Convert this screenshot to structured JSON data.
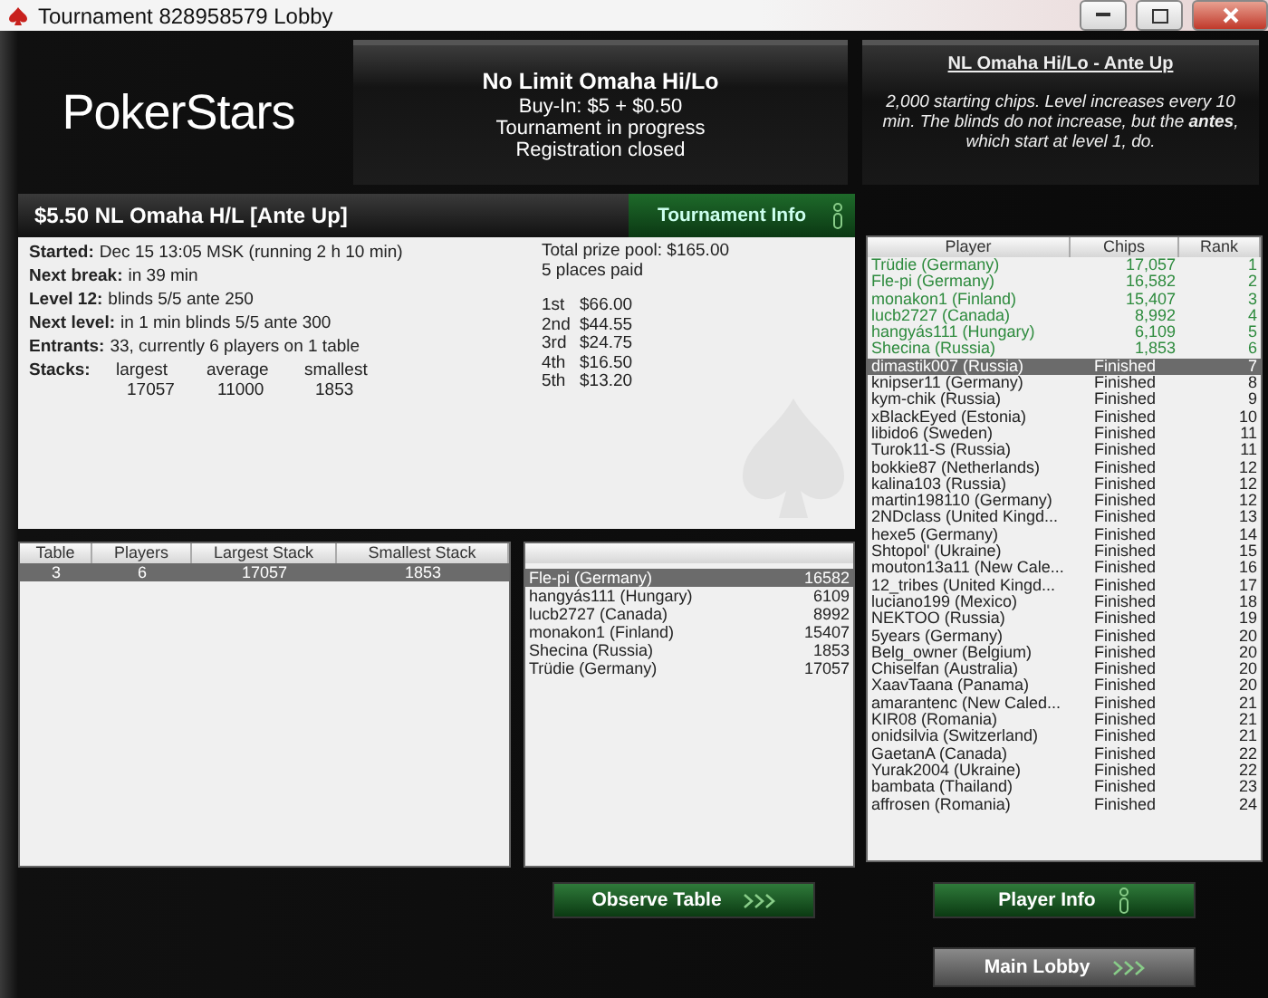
{
  "window": {
    "title": "Tournament 828958579 Lobby"
  },
  "logo": {
    "text": "PokerStars"
  },
  "summary": {
    "title": "No Limit Omaha Hi/Lo",
    "lines": [
      "Buy-In: $5 + $0.50",
      "Tournament in progress",
      "Registration closed"
    ]
  },
  "info": {
    "link": "NL Omaha Hi/Lo - Ante Up",
    "description": "2,000 starting chips. Level increases every 10 min. The blinds do not increase, but the **antes**, which start at level 1, do."
  },
  "details": {
    "title": "$5.50 NL Omaha H/L [Ante Up]",
    "tab": "Tournament Info",
    "facts": [
      {
        "label": "Started:",
        "value": "Dec 15 13:05 MSK (running 2 h 10 min)"
      },
      {
        "label": "Next break:",
        "value": "in 39 min"
      },
      {
        "label": "Level 12:",
        "value": "blinds 5/5 ante 250"
      },
      {
        "label": "Next level:",
        "value": "in 1 min blinds 5/5 ante 300"
      },
      {
        "label": "Entrants:",
        "value": "33, currently 6 players on 1 table"
      }
    ],
    "stacks": {
      "label": "Stacks:",
      "headers": [
        "largest",
        "average",
        "smallest"
      ],
      "values": [
        "17057",
        "11000",
        "1853"
      ]
    },
    "prize_pool": "Total prize pool: $165.00",
    "places_paid": "5 places paid",
    "payouts": [
      {
        "place": "1st",
        "amount": "$66.00"
      },
      {
        "place": "2nd",
        "amount": "$44.55"
      },
      {
        "place": "3rd",
        "amount": "$24.75"
      },
      {
        "place": "4th",
        "amount": "$16.50"
      },
      {
        "place": "5th",
        "amount": "$13.20"
      }
    ]
  },
  "tables": {
    "columns": [
      "Table",
      "Players",
      "Largest Stack",
      "Smallest Stack"
    ],
    "rows": [
      {
        "cells": [
          "3",
          "6",
          "17057",
          "1853"
        ],
        "selected": true
      }
    ]
  },
  "table_players": [
    {
      "name": "Fle-pi (Germany)",
      "chips": "16582",
      "selected": true
    },
    {
      "name": "hangyás111 (Hungary)",
      "chips": "6109",
      "selected": false
    },
    {
      "name": "lucb2727 (Canada)",
      "chips": "8992",
      "selected": false
    },
    {
      "name": "monakon1 (Finland)",
      "chips": "15407",
      "selected": false
    },
    {
      "name": "Shecina (Russia)",
      "chips": "1853",
      "selected": false
    },
    {
      "name": "Trüdie (Germany)",
      "chips": "17057",
      "selected": false
    }
  ],
  "players": {
    "columns": [
      "Player",
      "Chips",
      "Rank"
    ],
    "rows": [
      {
        "name": "Trüdie (Germany)",
        "chips": "17,057",
        "rank": "1",
        "kind": "playing",
        "selected": false
      },
      {
        "name": "Fle-pi (Germany)",
        "chips": "16,582",
        "rank": "2",
        "kind": "playing",
        "selected": false
      },
      {
        "name": "monakon1 (Finland)",
        "chips": "15,407",
        "rank": "3",
        "kind": "playing",
        "selected": false
      },
      {
        "name": "lucb2727 (Canada)",
        "chips": "8,992",
        "rank": "4",
        "kind": "playing",
        "selected": false
      },
      {
        "name": "hangyás111 (Hungary)",
        "chips": "6,109",
        "rank": "5",
        "kind": "playing",
        "selected": false
      },
      {
        "name": "Shecina (Russia)",
        "chips": "1,853",
        "rank": "6",
        "kind": "playing",
        "selected": false
      },
      {
        "name": "dimastik007 (Russia)",
        "chips": "Finished",
        "rank": "7",
        "kind": "finished",
        "selected": true
      },
      {
        "name": "knipser11 (Germany)",
        "chips": "Finished",
        "rank": "8",
        "kind": "finished",
        "selected": false
      },
      {
        "name": "kym-chik (Russia)",
        "chips": "Finished",
        "rank": "9",
        "kind": "finished",
        "selected": false
      },
      {
        "name": "xBlackEyed (Estonia)",
        "chips": "Finished",
        "rank": "10",
        "kind": "finished",
        "selected": false
      },
      {
        "name": "libido6 (Sweden)",
        "chips": "Finished",
        "rank": "11",
        "kind": "finished",
        "selected": false
      },
      {
        "name": "Turok11-S (Russia)",
        "chips": "Finished",
        "rank": "11",
        "kind": "finished",
        "selected": false
      },
      {
        "name": "bokkie87 (Netherlands)",
        "chips": "Finished",
        "rank": "12",
        "kind": "finished",
        "selected": false
      },
      {
        "name": "kalina103 (Russia)",
        "chips": "Finished",
        "rank": "12",
        "kind": "finished",
        "selected": false
      },
      {
        "name": "martin198110 (Germany)",
        "chips": "Finished",
        "rank": "12",
        "kind": "finished",
        "selected": false
      },
      {
        "name": "2NDclass (United Kingd...",
        "chips": "Finished",
        "rank": "13",
        "kind": "finished",
        "selected": false
      },
      {
        "name": "hexe5 (Germany)",
        "chips": "Finished",
        "rank": "14",
        "kind": "finished",
        "selected": false
      },
      {
        "name": "Shtopol' (Ukraine)",
        "chips": "Finished",
        "rank": "15",
        "kind": "finished",
        "selected": false
      },
      {
        "name": "mouton13a11 (New Cale...",
        "chips": "Finished",
        "rank": "16",
        "kind": "finished",
        "selected": false
      },
      {
        "name": "12_tribes (United Kingd...",
        "chips": "Finished",
        "rank": "17",
        "kind": "finished",
        "selected": false
      },
      {
        "name": "luciano199 (Mexico)",
        "chips": "Finished",
        "rank": "18",
        "kind": "finished",
        "selected": false
      },
      {
        "name": "NEKTOO (Russia)",
        "chips": "Finished",
        "rank": "19",
        "kind": "finished",
        "selected": false
      },
      {
        "name": "5years (Germany)",
        "chips": "Finished",
        "rank": "20",
        "kind": "finished",
        "selected": false
      },
      {
        "name": "Belg_owner (Belgium)",
        "chips": "Finished",
        "rank": "20",
        "kind": "finished",
        "selected": false
      },
      {
        "name": "Chiselfan (Australia)",
        "chips": "Finished",
        "rank": "20",
        "kind": "finished",
        "selected": false
      },
      {
        "name": "XaavTaana (Panama)",
        "chips": "Finished",
        "rank": "20",
        "kind": "finished",
        "selected": false
      },
      {
        "name": "amarantenc (New Caled...",
        "chips": "Finished",
        "rank": "21",
        "kind": "finished",
        "selected": false
      },
      {
        "name": "KIR08 (Romania)",
        "chips": "Finished",
        "rank": "21",
        "kind": "finished",
        "selected": false
      },
      {
        "name": "onidsilvia (Switzerland)",
        "chips": "Finished",
        "rank": "21",
        "kind": "finished",
        "selected": false
      },
      {
        "name": "GaetanA (Canada)",
        "chips": "Finished",
        "rank": "22",
        "kind": "finished",
        "selected": false
      },
      {
        "name": "Yurak2004 (Ukraine)",
        "chips": "Finished",
        "rank": "22",
        "kind": "finished",
        "selected": false
      },
      {
        "name": "bambata (Thailand)",
        "chips": "Finished",
        "rank": "23",
        "kind": "finished",
        "selected": false
      },
      {
        "name": "affrosen (Romania)",
        "chips": "Finished",
        "rank": "24",
        "kind": "finished",
        "selected": false
      }
    ]
  },
  "buttons": [
    {
      "label": "Observe Table",
      "kind": "arrows"
    },
    {
      "label": "Player Info",
      "kind": "info"
    },
    {
      "label": "Main Lobby",
      "kind": "arrows"
    }
  ]
}
